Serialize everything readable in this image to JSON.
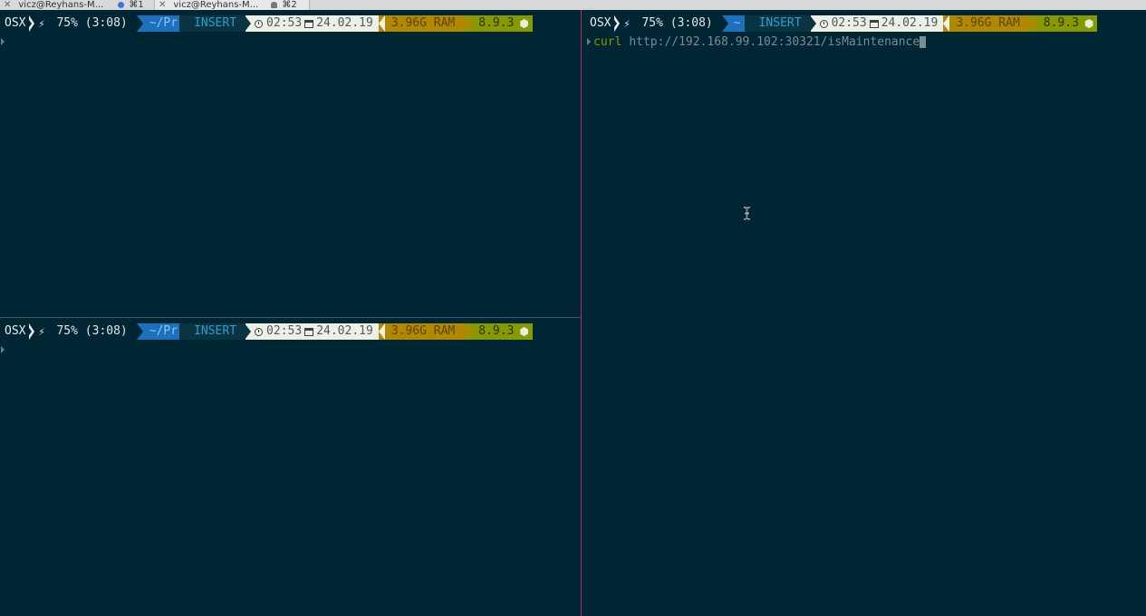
{
  "tabs": [
    {
      "title": "vicz@Reyhans-M...",
      "shortcut": "⌘1",
      "indicator": "activity-dot"
    },
    {
      "title": "vicz@Reyhans-M...",
      "shortcut": "⌘2",
      "indicator": "bell"
    }
  ],
  "status": {
    "os": "OSX",
    "battery": "75% (3:08)",
    "path_short": "~/Pr",
    "path_right": "~",
    "mode": "INSERT",
    "time": "02:53",
    "date": "24.02.19",
    "ram": "3.96G RAM",
    "node_version": "8.9.3"
  },
  "right_pane": {
    "command": "curl",
    "argument": "http://192.168.99.102:30321/isMaintenance"
  },
  "colors": {
    "background": "#002633",
    "divider": "#c2286a",
    "path": "#1f6fbf",
    "ram": "#b18800",
    "node": "#879900"
  }
}
